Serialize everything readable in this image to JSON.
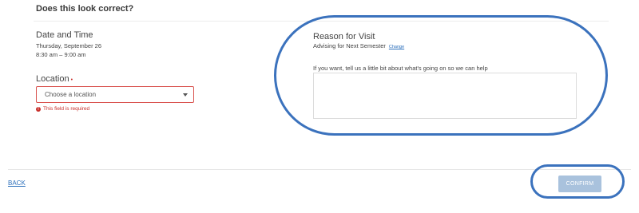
{
  "header": {
    "title": "Does this look correct?"
  },
  "date_time": {
    "heading": "Date and Time",
    "date": "Thursday, September 26",
    "time": "8:30 am – 9:00 am"
  },
  "location": {
    "label": "Location",
    "required_marker": "•",
    "select_value": "Choose a location",
    "error": "This field is required",
    "error_icon": "!"
  },
  "reason": {
    "heading": "Reason for Visit",
    "value": "Advising for Next Semester",
    "change_label": "Change",
    "notes_prompt": "If you want, tell us a little bit about what's going on so we can help",
    "notes_value": ""
  },
  "footer": {
    "back_label": "BACK",
    "confirm_label": "CONFIRM"
  },
  "colors": {
    "highlight": "#3b72bd",
    "error": "#c9302c",
    "link": "#2a6ebb",
    "confirm_disabled": "#a9c2dd"
  }
}
